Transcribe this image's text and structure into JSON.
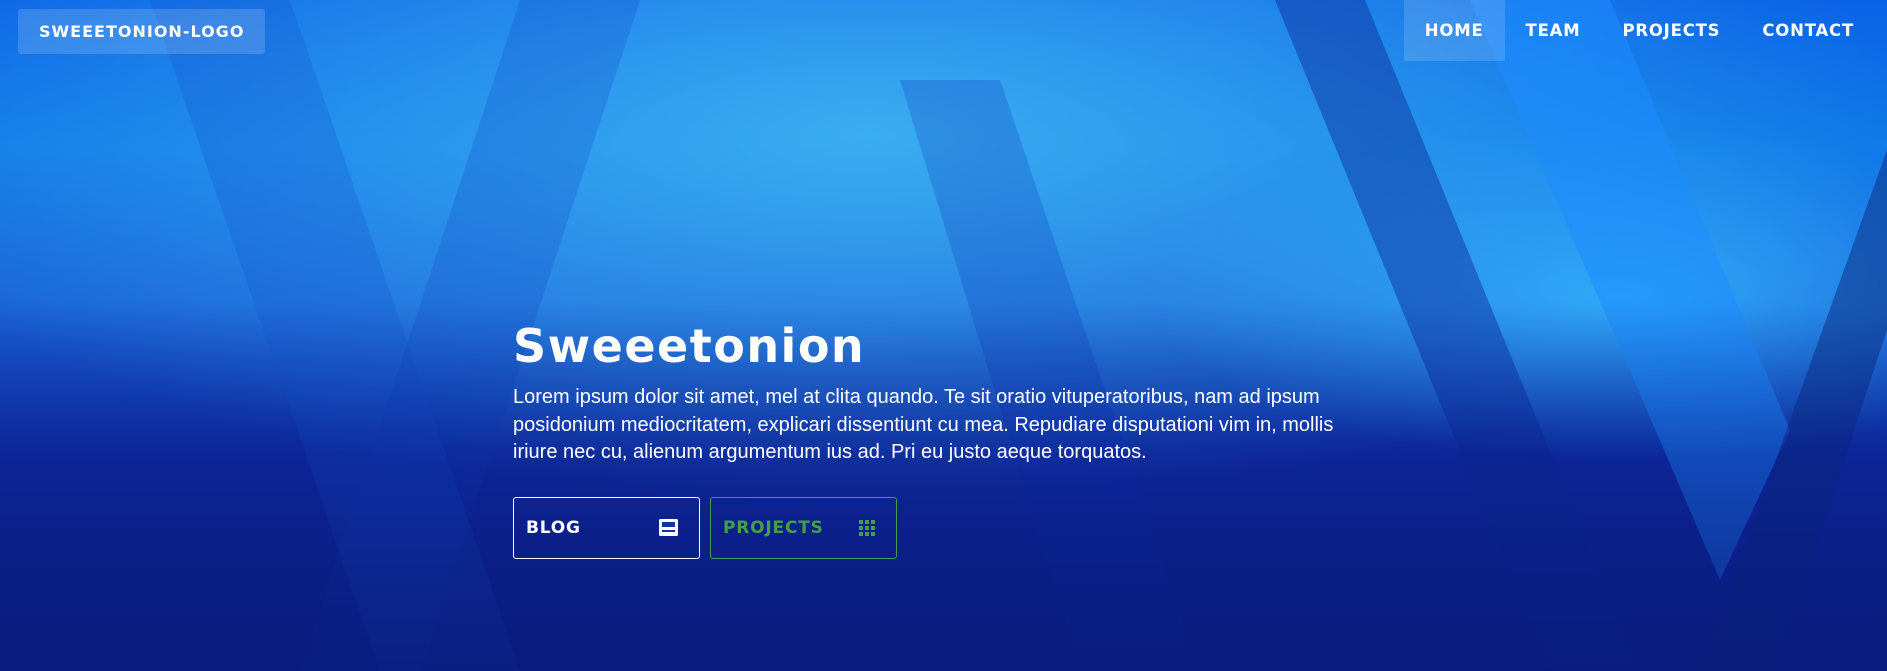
{
  "header": {
    "logo_text": "SWEEETONION-LOGO",
    "nav": [
      {
        "label": "HOME",
        "active": true
      },
      {
        "label": "TEAM",
        "active": false
      },
      {
        "label": "PROJECTS",
        "active": false
      },
      {
        "label": "CONTACT",
        "active": false
      }
    ]
  },
  "hero": {
    "title": "Sweeetonion",
    "lead": "Lorem ipsum dolor sit amet, mel at clita quando. Te sit oratio vituperatoribus, nam ad ipsum posidonium mediocritatem, explicari dissentiunt cu mea. Repudiare disputationi vim in, mollis iriure nec cu, alienum argumentum ius ad. Pri eu justo aeque torquatos.",
    "buttons": {
      "blog": {
        "label": "BLOG",
        "icon": "blog-icon"
      },
      "projects": {
        "label": "PROJECTS",
        "icon": "grid-icon"
      }
    }
  },
  "colors": {
    "background": "#0d2aa5",
    "accent_green": "#43a047",
    "text": "#ffffff"
  }
}
